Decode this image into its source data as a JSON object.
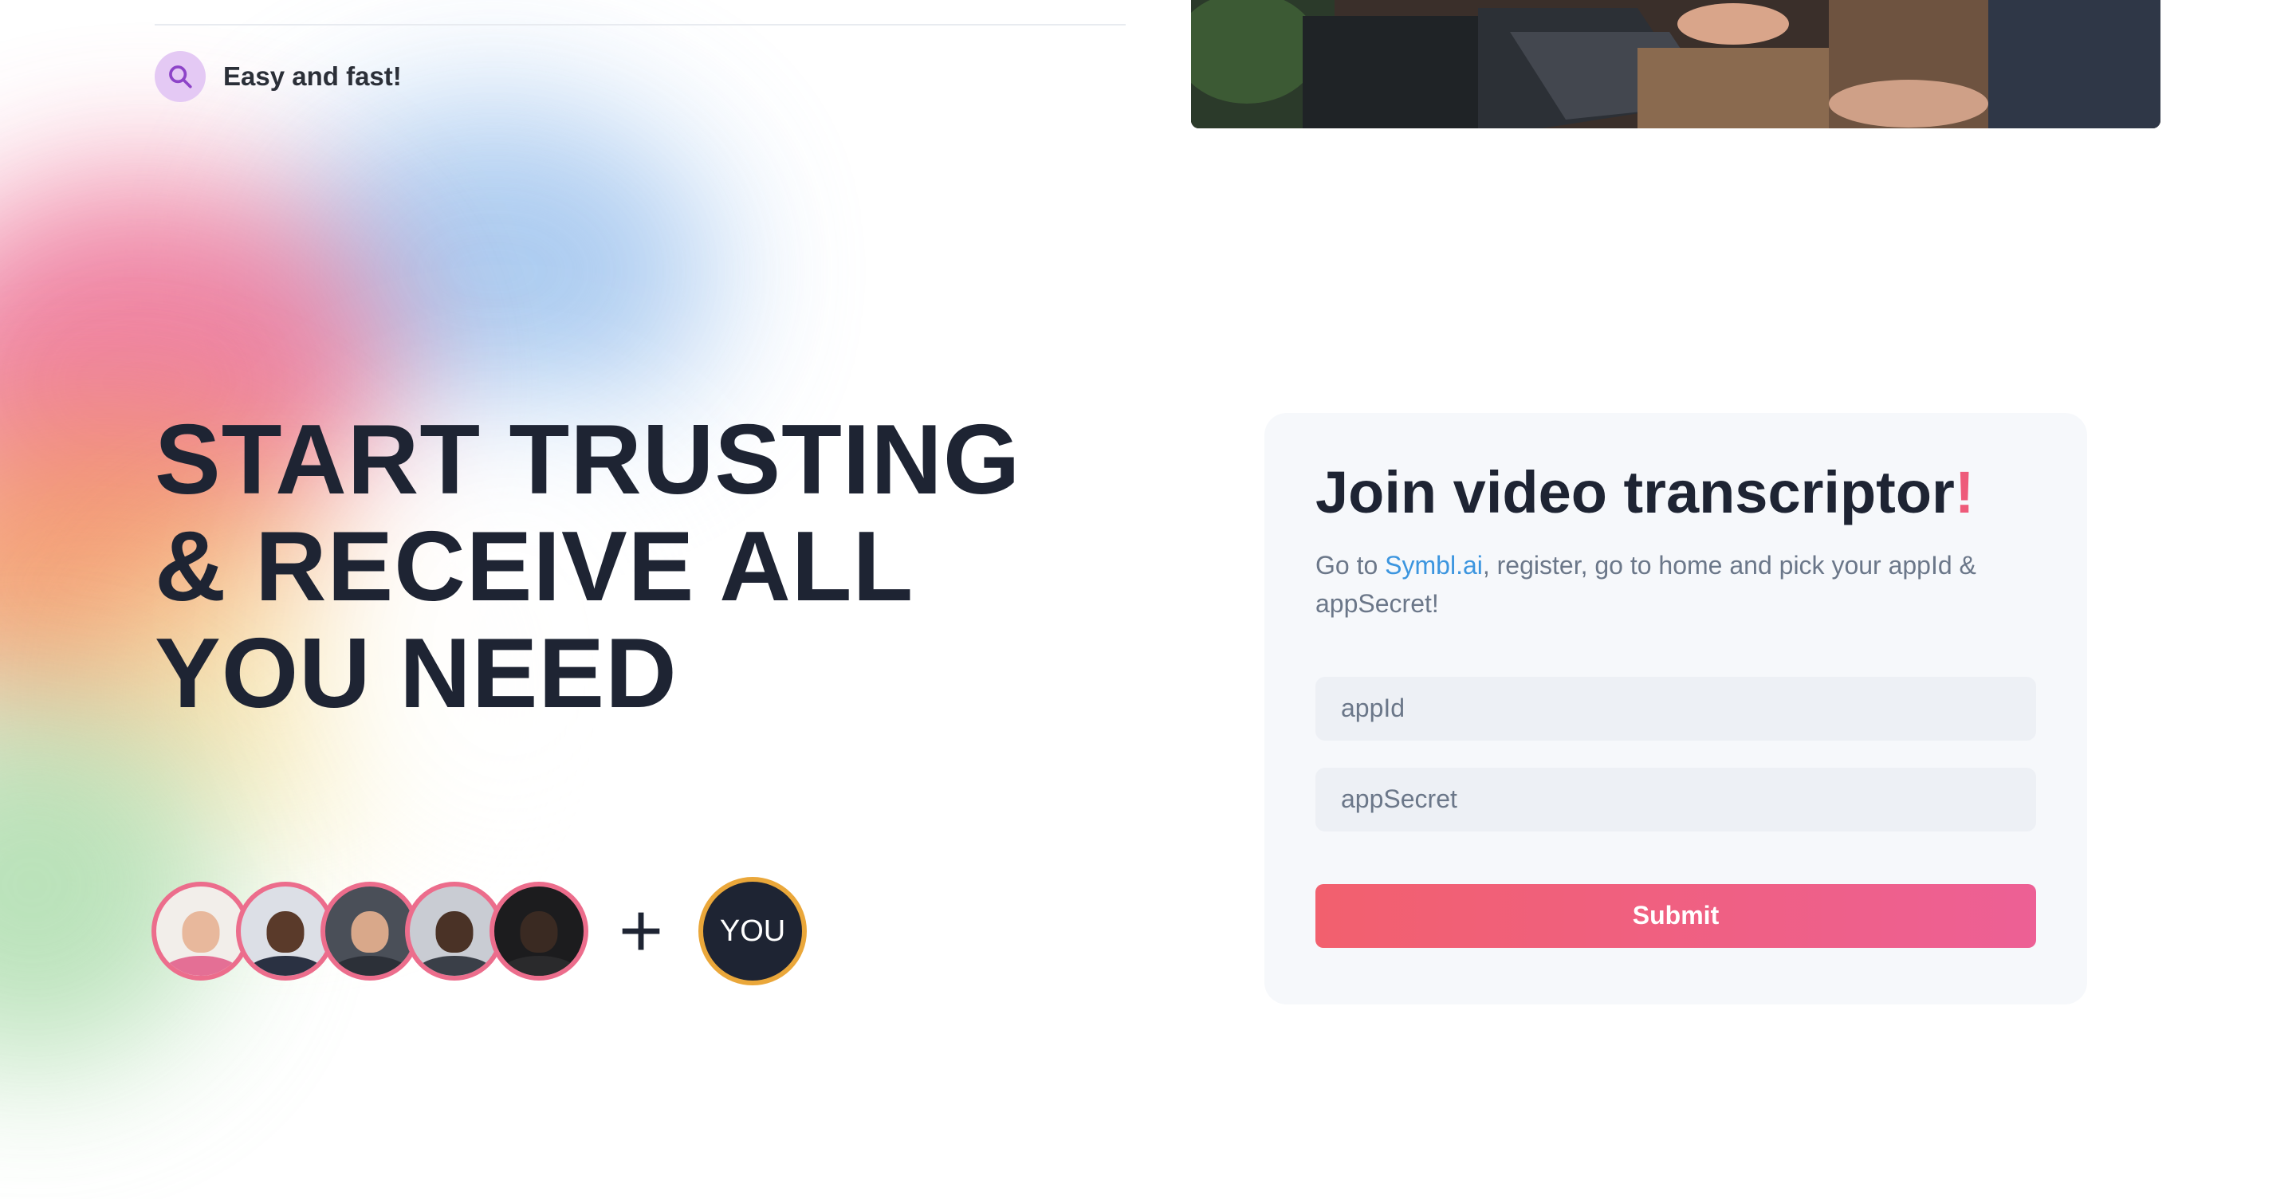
{
  "feature": {
    "icon": "search-icon",
    "label": "Easy and fast!"
  },
  "hero": {
    "headline_lines": [
      "START TRUSTING",
      "& RECEIVE ALL",
      "YOU NEED"
    ]
  },
  "community": {
    "plus": "+",
    "you_label": "YOU",
    "avatar_count": 5
  },
  "form": {
    "title_main": "Join video transcriptor",
    "title_accent": "!",
    "desc_prefix": "Go to ",
    "desc_link": "Symbl.ai",
    "desc_suffix": ", register, go to home and pick your appId & appSecret!",
    "appid_placeholder": "appId",
    "appsecret_placeholder": "appSecret",
    "submit_label": "Submit"
  },
  "colors": {
    "accent_pink": "#ee5b7a",
    "link_blue": "#3b95df",
    "dark_text": "#1e2433",
    "avatar_ring": "#ec6d8c",
    "you_ring": "#eaa73a"
  }
}
